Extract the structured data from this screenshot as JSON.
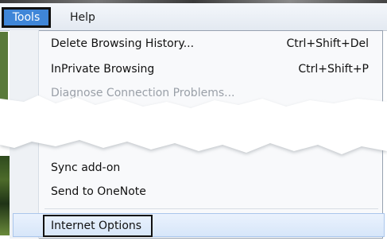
{
  "menubar": {
    "tools_label": "Tools",
    "help_label": "Help"
  },
  "menu": {
    "items_top": [
      {
        "label": "Delete Browsing History...",
        "shortcut": "Ctrl+Shift+Del"
      },
      {
        "label": "InPrivate Browsing",
        "shortcut": "Ctrl+Shift+P"
      },
      {
        "label": "Diagnose Connection Problems..."
      }
    ],
    "items_bottom": [
      {
        "label": "Sync add-on"
      },
      {
        "label": "Send to OneNote"
      }
    ],
    "internet_options_label": "Internet Options"
  }
}
